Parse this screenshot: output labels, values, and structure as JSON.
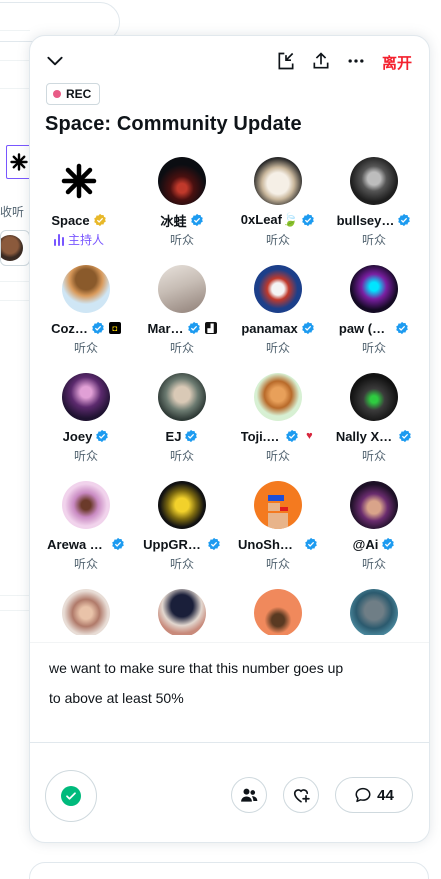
{
  "background": {
    "fragment_text": "收听"
  },
  "space": {
    "rec_label": "REC",
    "title": "Space: Community Update",
    "leave_label": "离开",
    "caption_line_1": "we want to make sure that this number goes up",
    "caption_line_2": "to above at least 50%",
    "comment_count": "44",
    "colors": {
      "accent_purple": "#7856ff",
      "leave_red": "#f4212e",
      "verified_blue": "#1d9bf0",
      "verified_gold": "#e8b829",
      "check_green": "#00ba7c"
    }
  },
  "participants": [
    {
      "name": "Space",
      "role": "主持人",
      "badge": "gold",
      "host": true
    },
    {
      "name": "冰蛙",
      "role": "听众",
      "badge": "blue"
    },
    {
      "name": "0xLeaf🍃",
      "role": "听众",
      "badge": "blue"
    },
    {
      "name": "bullsey…",
      "role": "听众",
      "badge": "blue"
    },
    {
      "name": "Coz…",
      "role": "听众",
      "badge": "blue",
      "extra": "square-icon"
    },
    {
      "name": "Mar…",
      "role": "听众",
      "badge": "blue",
      "extra": "chart-icon"
    },
    {
      "name": "panamax",
      "role": "听众",
      "badge": "blue"
    },
    {
      "name": "paw (…",
      "role": "听众",
      "badge": "blue"
    },
    {
      "name": "Joey",
      "role": "听众",
      "badge": "blue"
    },
    {
      "name": "EJ",
      "role": "听众",
      "badge": "blue"
    },
    {
      "name": "Toji.…",
      "role": "听众",
      "badge": "blue",
      "extra": "heart-icon"
    },
    {
      "name": "Nally X…",
      "role": "听众",
      "badge": "blue"
    },
    {
      "name": "Arewa …",
      "role": "听众",
      "badge": "blue"
    },
    {
      "name": "UppGR…",
      "role": "听众",
      "badge": "blue"
    },
    {
      "name": "UnoSha…",
      "role": "听众",
      "badge": "blue"
    },
    {
      "name": "@Ai",
      "role": "听众",
      "badge": "blue"
    },
    {
      "name": "",
      "role": "",
      "badge": "none"
    },
    {
      "name": "",
      "role": "",
      "badge": "none"
    },
    {
      "name": "",
      "role": "",
      "badge": "none"
    },
    {
      "name": "",
      "role": "",
      "badge": "none"
    }
  ]
}
